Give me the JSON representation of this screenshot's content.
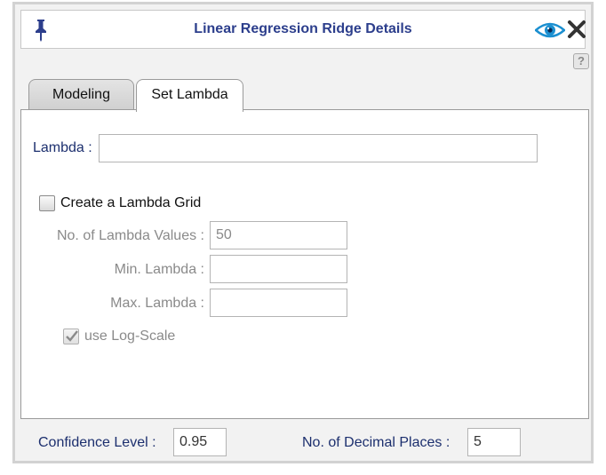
{
  "window": {
    "title": "Linear Regression Ridge Details"
  },
  "tabs": [
    {
      "label": "Modeling",
      "active": false
    },
    {
      "label": "Set Lambda",
      "active": true
    }
  ],
  "lambda": {
    "label": "Lambda :",
    "value": ""
  },
  "grid": {
    "checkbox_label": "Create a Lambda Grid",
    "checked": false,
    "num_values_label": "No. of Lambda Values :",
    "num_values": "50",
    "min_label": "Min. Lambda :",
    "min_value": "",
    "max_label": "Max. Lambda :",
    "max_value": "",
    "log_scale_label": "use Log-Scale",
    "log_scale_checked": true
  },
  "footer": {
    "confidence_label": "Confidence Level :",
    "confidence_value": "0.95",
    "decimal_label": "No. of Decimal Places :",
    "decimal_value": "5"
  },
  "help": {
    "glyph": "?"
  },
  "colors": {
    "title": "#2c3e8c",
    "label_blue": "#1c2f6e",
    "disabled_text": "#8a8a8a"
  }
}
